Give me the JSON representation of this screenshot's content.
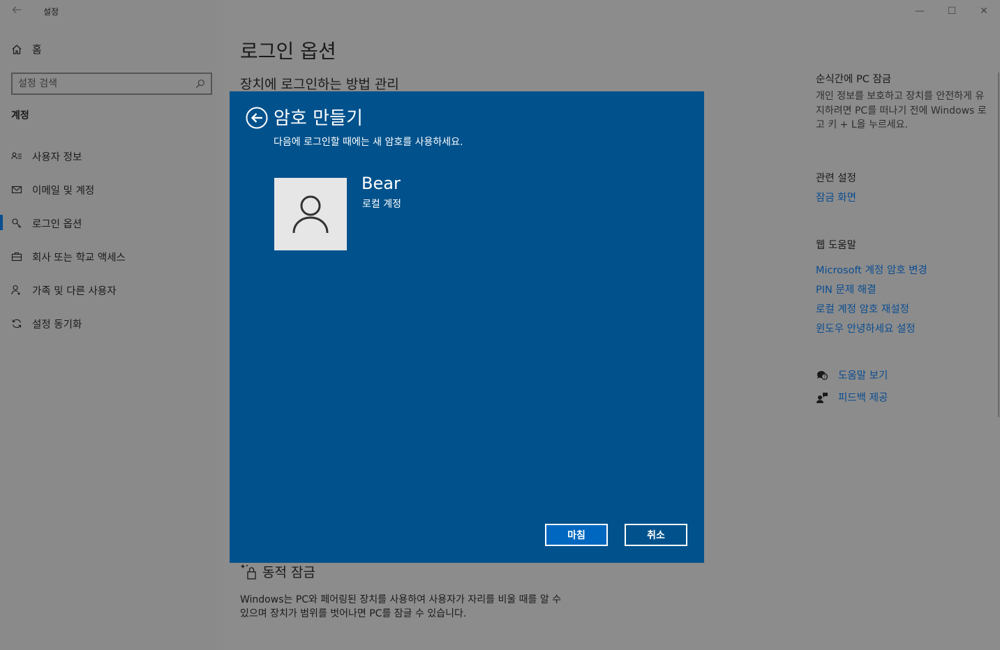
{
  "window": {
    "title": "설정",
    "back_icon": "arrow-left-icon",
    "controls": {
      "minimize": "—",
      "maximize": "☐",
      "close": "✕"
    }
  },
  "sidebar": {
    "home_label": "홈",
    "search": {
      "placeholder": "설정 검색",
      "value": ""
    },
    "section_label": "계정",
    "items": [
      {
        "label": "사용자 정보",
        "icon": "person-card-icon",
        "active": false
      },
      {
        "label": "이메일 및 계정",
        "icon": "mail-icon",
        "active": false
      },
      {
        "label": "로그인 옵션",
        "icon": "key-icon",
        "active": true
      },
      {
        "label": "회사 또는 학교 액세스",
        "icon": "briefcase-icon",
        "active": false
      },
      {
        "label": "가족 및 다른 사용자",
        "icon": "person-add-icon",
        "active": false
      },
      {
        "label": "설정 동기화",
        "icon": "sync-icon",
        "active": false
      }
    ]
  },
  "main": {
    "title": "로그인 옵션",
    "subtitle": "장치에 로그인하는 방법 관리",
    "dynamic_lock": {
      "title": "동적 잠금",
      "description": "Windows는 PC와 페어링된 장치를 사용하여 사용자가 자리를 비울 때를 알 수 있으며 장치가 범위를 벗어나면 PC를 잠글 수 있습니다."
    }
  },
  "right": {
    "lock_heading": "순식간에 PC 잠금",
    "lock_text": "개인 정보를 보호하고 장치를 안전하게 유지하려면 PC를 떠나기 전에 Windows 로고 키 + L을 누르세요.",
    "related_heading": "관련 설정",
    "related_link": "잠금 화면",
    "web_help_heading": "웹 도움말",
    "web_links": [
      "Microsoft 계정 암호 변경",
      "PIN 문제 해결",
      "로컬 계정 암호 재설정",
      "윈도우 안녕하세요 설정"
    ],
    "help_link": "도움말 보기",
    "feedback_link": "피드백 제공"
  },
  "dialog": {
    "title": "암호 만들기",
    "subtitle": "다음에 로그인할 때에는 새 암호를 사용하세요.",
    "user_name": "Bear",
    "account_type": "로컬 계정",
    "finish_label": "마침",
    "cancel_label": "취소",
    "background_color": "#00518c"
  }
}
